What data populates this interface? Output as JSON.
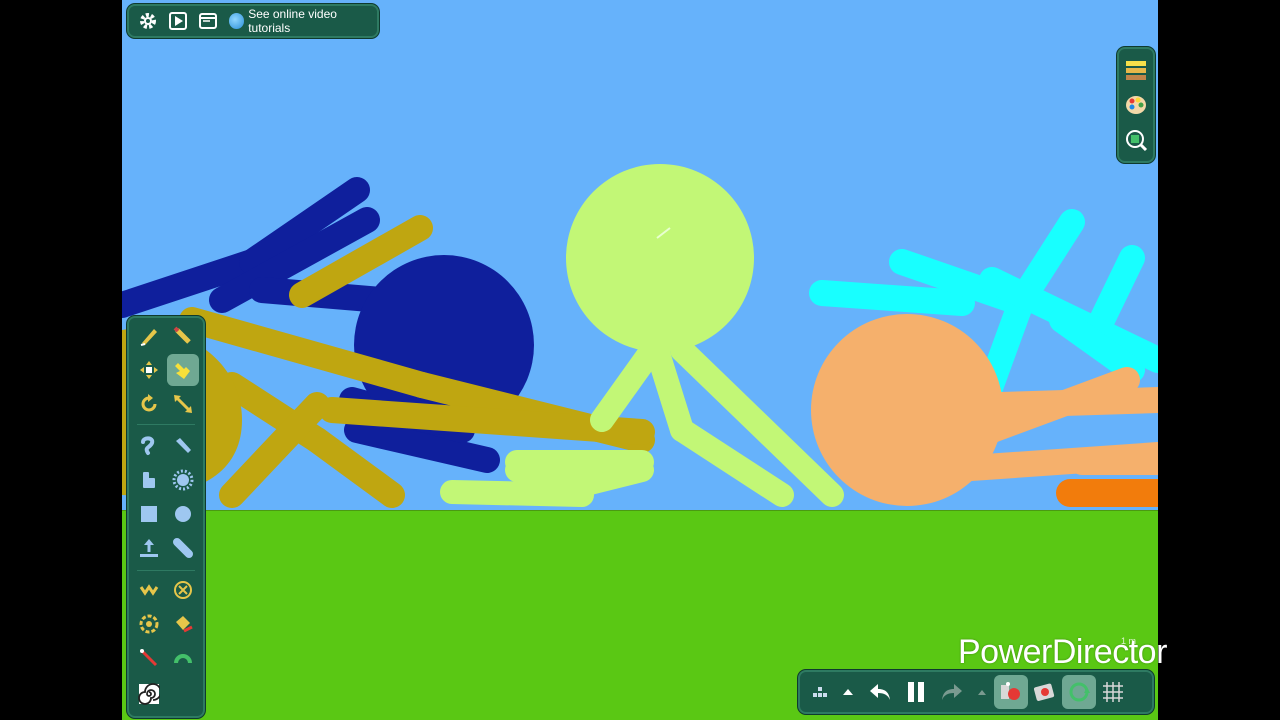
{
  "app": {
    "top_toolbar": {
      "settings_icon": "gear-icon",
      "play_icon": "play-preview-icon",
      "window_icon": "window-icon",
      "tutorials_label": "See online video tutorials"
    },
    "right_panel": [
      "layers-icon",
      "palette-icon",
      "zoom-icon"
    ],
    "tools": [
      "pencil-draw-icon",
      "pencil-edit-icon",
      "move-icon",
      "hand-select-icon",
      "rotate-icon",
      "scale-icon",
      "curve-icon",
      "knife-icon",
      "thumb-icon",
      "star-burst-icon",
      "square-icon",
      "circle-icon",
      "import-icon",
      "capsule-icon",
      "zigzag-icon",
      "delete-circle-icon",
      "target-icon",
      "paint-bucket-icon",
      "line-icon",
      "arc-icon",
      "spiral-icon"
    ],
    "selected_tool": "hand-select-icon",
    "bottom_bar": [
      "menu-grid-icon",
      "up-arrow-icon",
      "undo-icon",
      "pause-icon",
      "redo-icon",
      "up-arrow-small-icon",
      "onion-skin-icon",
      "frame-icon",
      "loop-icon",
      "grid-icon"
    ]
  },
  "colors": {
    "sky": "#66b2fb",
    "ground": "#5ac814",
    "panel": "#1a5a48",
    "stick_navy": "#0f1f9c",
    "stick_gold": "#bfa611",
    "stick_lime": "#c2f776",
    "stick_cyan": "#18ffff",
    "stick_peach": "#f5b06c",
    "stick_orange": "#f27c0c"
  },
  "watermark": {
    "text": "PowerDirector",
    "small": "1 m"
  }
}
